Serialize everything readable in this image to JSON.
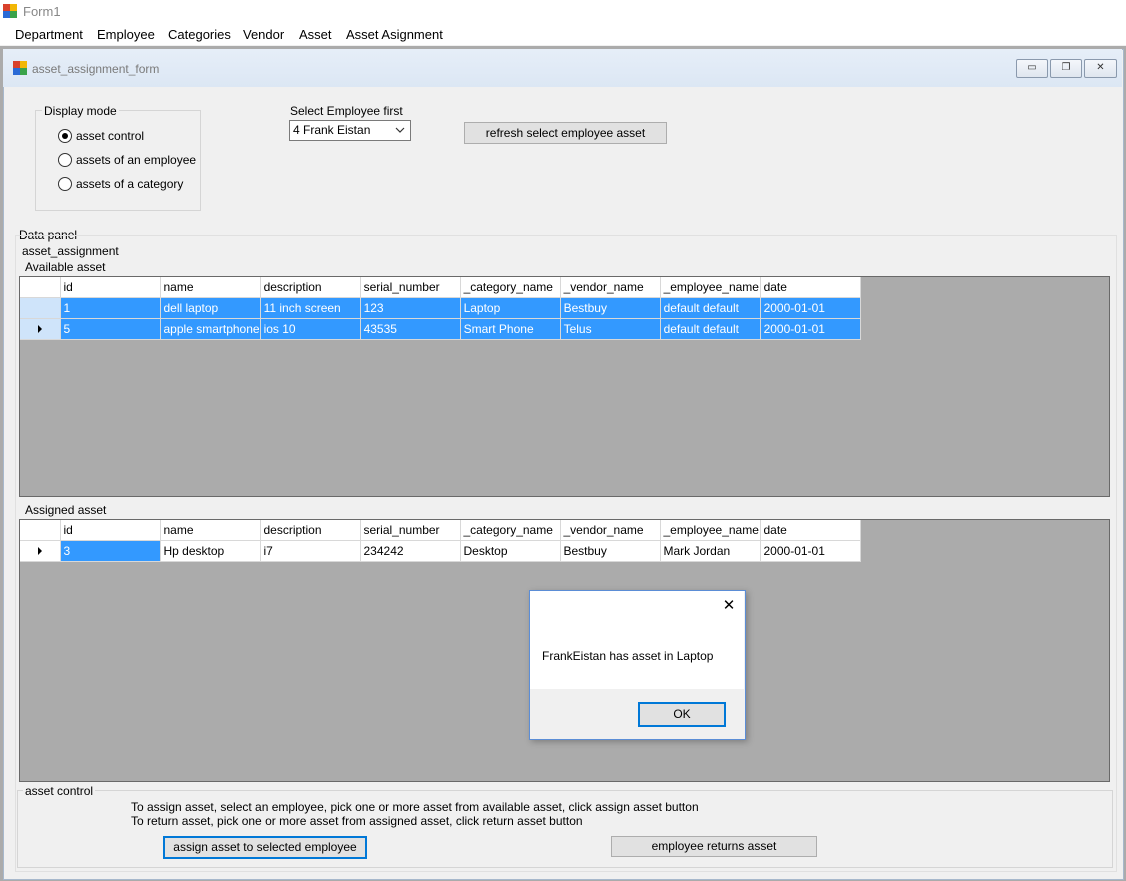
{
  "app": {
    "title": "Form1"
  },
  "menu": [
    "Department",
    "Employee",
    "Categories",
    "Vendor",
    "Asset",
    "Asset Asignment"
  ],
  "child": {
    "title": "asset_assignment_form",
    "caption_buttons": {
      "minimize": "▭",
      "restore": "❐",
      "close": "✕"
    }
  },
  "display_mode": {
    "label": "Display mode",
    "options": [
      "asset control",
      "assets of an employee",
      "assets of a category"
    ],
    "selected_index": 0
  },
  "employee_select": {
    "label": "Select Employee first",
    "value": "4 Frank Eistan"
  },
  "refresh_button": "refresh select employee asset",
  "data_panel": {
    "label": "Data panel",
    "sub_label": "asset_assignment"
  },
  "columns": [
    "id",
    "name",
    "description",
    "serial_number",
    "_category_name",
    "_vendor_name",
    "_employee_name",
    "date"
  ],
  "available": {
    "label": "Available asset",
    "rows": [
      [
        "1",
        "dell laptop",
        "11 inch screen",
        "123",
        "Laptop",
        "Bestbuy",
        "default default",
        "2000-01-01"
      ],
      [
        "5",
        "apple smartphone",
        "ios 10",
        "43535",
        "Smart Phone",
        "Telus",
        "default default",
        "2000-01-01"
      ]
    ]
  },
  "assigned": {
    "label": "Assigned asset",
    "rows": [
      [
        "3",
        "Hp desktop",
        "i7",
        "234242",
        "Desktop",
        "Bestbuy",
        "Mark Jordan",
        "2000-01-01"
      ]
    ]
  },
  "asset_control": {
    "label": "asset control",
    "line1": "To assign asset, select an employee, pick one or more asset from available asset, click assign asset button",
    "line2": "To return asset, pick one or more asset from assigned asset, click return asset button",
    "assign_button": "assign asset to selected employee",
    "return_button": "employee returns asset"
  },
  "dialog": {
    "message": "FrankEistan has asset in Laptop",
    "ok": "OK",
    "close": "✕"
  }
}
